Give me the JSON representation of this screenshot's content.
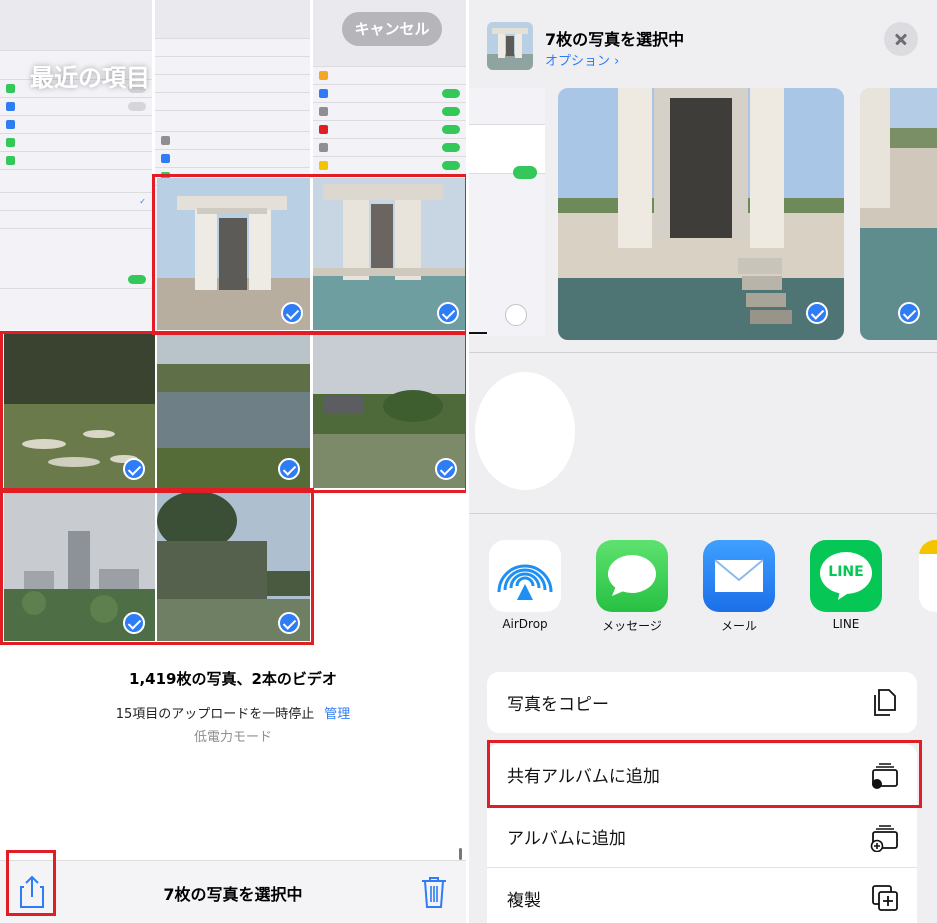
{
  "left": {
    "album_title": "最近の項目",
    "cancel_label": "キャンセル",
    "counts": "1,419枚の写真、2本のビデオ",
    "upload_status": "15項目のアップロードを一時停止",
    "manage_label": "管理",
    "mode_label": "低電力モード",
    "toolbar_title": "7枚の写真を選択中",
    "share_icon": "share-icon",
    "trash_icon": "trash-icon"
  },
  "right": {
    "sheet_title": "7枚の写真を選択中",
    "options_label": "オプション ›",
    "apps": [
      {
        "label": "AirDrop",
        "icon": "airdrop-icon"
      },
      {
        "label": "メッセージ",
        "icon": "messages-icon"
      },
      {
        "label": "メール",
        "icon": "mail-icon"
      },
      {
        "label": "LINE",
        "icon": "line-icon",
        "tile_text": "LINE"
      }
    ],
    "actions": [
      {
        "label": "写真をコピー",
        "icon": "copy-icon"
      },
      {
        "label": "共有アルバムに追加",
        "icon": "shared-album-icon"
      },
      {
        "label": "アルバムに追加",
        "icon": "add-album-icon"
      },
      {
        "label": "複製",
        "icon": "duplicate-icon"
      }
    ]
  },
  "colors": {
    "accent": "#2e7cf6",
    "highlight_red": "#e11d25",
    "toggle_green": "#34c759",
    "line_green": "#06c755",
    "messages_green": "#34c759",
    "mail_blue": "#2f86f6"
  }
}
